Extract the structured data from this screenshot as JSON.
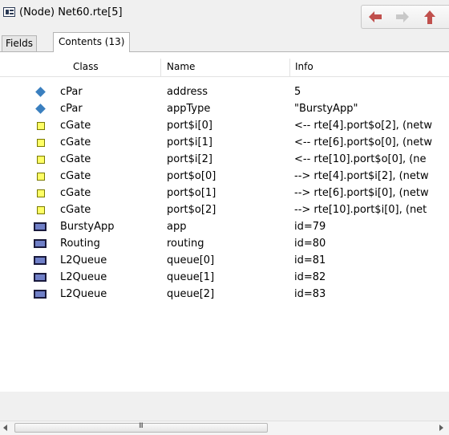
{
  "window": {
    "title": "(Node) Net60.rte[5]"
  },
  "nav": {
    "back_icon": "arrow-left-icon",
    "forward_icon": "arrow-right-icon",
    "up_icon": "arrow-up-icon",
    "accent": "#c0504d"
  },
  "tabs": [
    {
      "label": "Fields"
    },
    {
      "label": "Contents (13)"
    }
  ],
  "table": {
    "columns": [
      "Class",
      "Name",
      "Info"
    ],
    "rows": [
      {
        "icon": "parameter-icon",
        "class": "cPar",
        "name": "address",
        "info": "5"
      },
      {
        "icon": "parameter-icon",
        "class": "cPar",
        "name": "appType",
        "info": "\"BurstyApp\""
      },
      {
        "icon": "gate-icon",
        "class": "cGate",
        "name": "port$i[0]",
        "info": "<-- rte[4].port$o[2], (netw"
      },
      {
        "icon": "gate-icon",
        "class": "cGate",
        "name": "port$i[1]",
        "info": "<-- rte[6].port$o[0], (netw"
      },
      {
        "icon": "gate-icon",
        "class": "cGate",
        "name": "port$i[2]",
        "info": "<-- rte[10].port$o[0], (ne"
      },
      {
        "icon": "gate-icon",
        "class": "cGate",
        "name": "port$o[0]",
        "info": "--> rte[4].port$i[2], (netw"
      },
      {
        "icon": "gate-icon",
        "class": "cGate",
        "name": "port$o[1]",
        "info": "--> rte[6].port$i[0], (netw"
      },
      {
        "icon": "gate-icon",
        "class": "cGate",
        "name": "port$o[2]",
        "info": "--> rte[10].port$i[0], (net"
      },
      {
        "icon": "module-icon",
        "class": "BurstyApp",
        "name": "app",
        "info": "id=79"
      },
      {
        "icon": "module-icon",
        "class": "Routing",
        "name": "routing",
        "info": "id=80"
      },
      {
        "icon": "module-icon",
        "class": "L2Queue",
        "name": "queue[0]",
        "info": "id=81"
      },
      {
        "icon": "module-icon",
        "class": "L2Queue",
        "name": "queue[1]",
        "info": "id=82"
      },
      {
        "icon": "module-icon",
        "class": "L2Queue",
        "name": "queue[2]",
        "info": "id=83"
      }
    ]
  },
  "scrollbar": {
    "grip": "III"
  }
}
